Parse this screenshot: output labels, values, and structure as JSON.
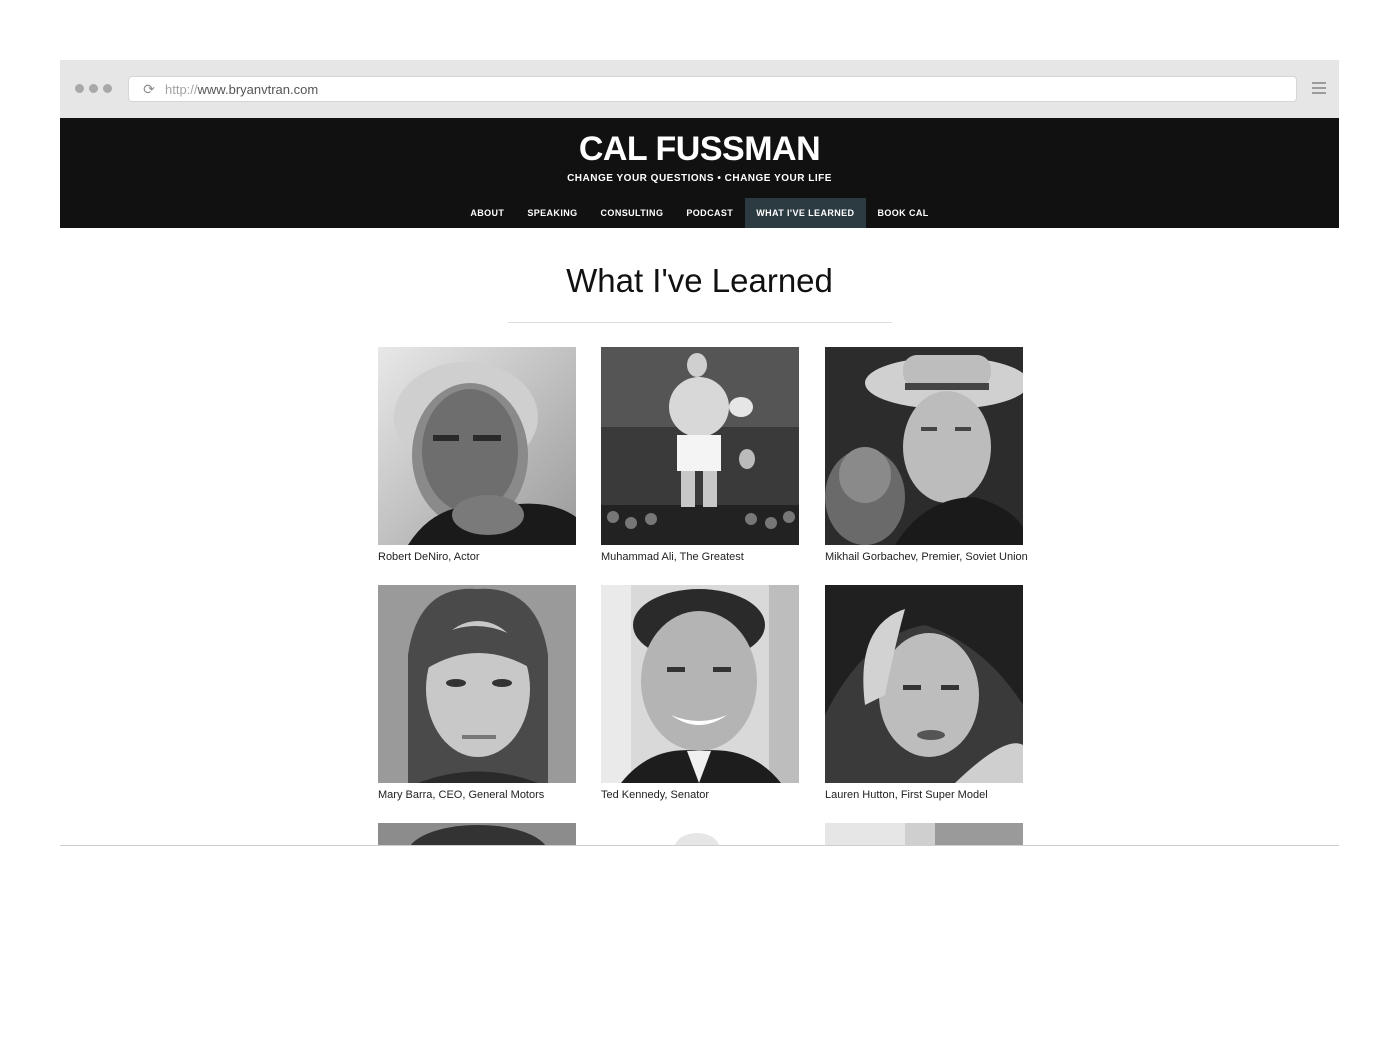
{
  "browser": {
    "url_protocol": "http://",
    "url_host": "www.bryanvtran.com"
  },
  "header": {
    "logo": "CAL FUSSMAN",
    "tagline": "CHANGE YOUR QUESTIONS • CHANGE YOUR LIFE"
  },
  "nav": {
    "items": [
      {
        "label": "ABOUT"
      },
      {
        "label": "SPEAKING"
      },
      {
        "label": "CONSULTING"
      },
      {
        "label": "PODCAST"
      },
      {
        "label": "WHAT I'VE LEARNED"
      },
      {
        "label": "BOOK CAL"
      }
    ],
    "active_index": 4,
    "active_color": "#2c3a42"
  },
  "page": {
    "title": "What I've Learned"
  },
  "interviews": [
    {
      "caption": "Robert DeNiro, Actor"
    },
    {
      "caption": "Muhammad Ali, The Greatest"
    },
    {
      "caption": "Mikhail Gorbachev, Premier, Soviet Union"
    },
    {
      "caption": "Mary Barra, CEO, General Motors"
    },
    {
      "caption": "Ted Kennedy, Senator"
    },
    {
      "caption": "Lauren Hutton, First Super Model"
    }
  ]
}
